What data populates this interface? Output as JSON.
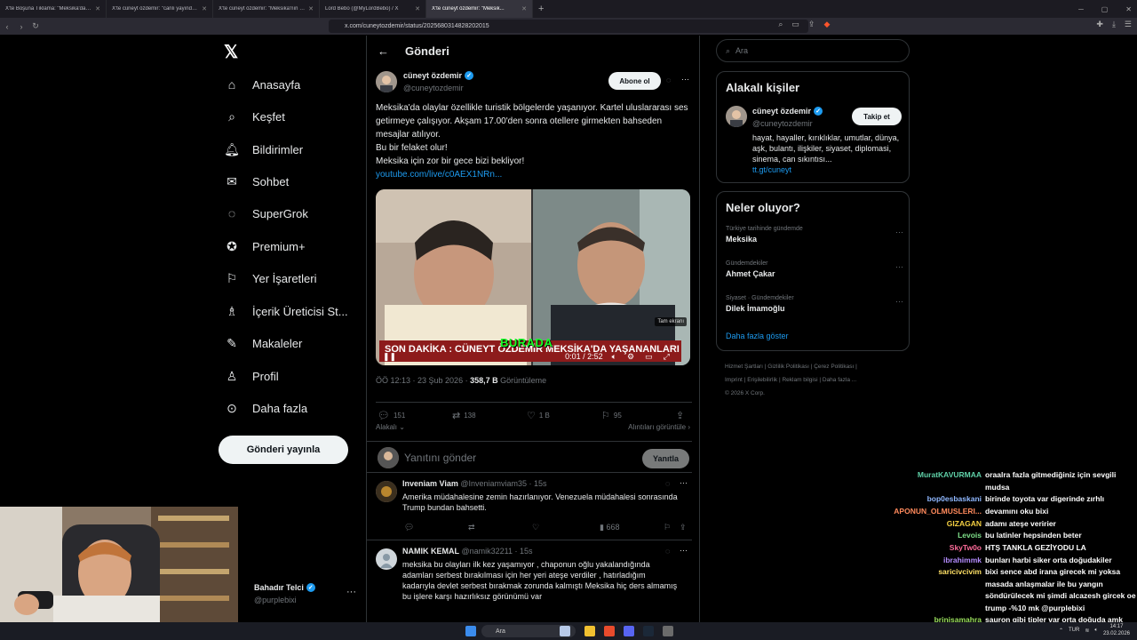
{
  "browser": {
    "tabs": [
      {
        "label": "X'te Boşuna Tıklama: \"Meksika'da ma...",
        "active": false
      },
      {
        "label": "X'te cüneyt özdemir: \"canlı yayındayı...",
        "active": false
      },
      {
        "label": "X'te cüneyt özdemir: \"Meksika'nın sa...",
        "active": false
      },
      {
        "label": "Lord Bebo (@MyLordBebo) / X",
        "active": false
      },
      {
        "label": "X'te cüneyt özdemir: \"Meksik...",
        "active": true
      }
    ],
    "url": "x.com/cuneytozdemir/status/2025680314828202015"
  },
  "nav": {
    "items": [
      {
        "label": "Anasayfa",
        "icon": "home-icon"
      },
      {
        "label": "Keşfet",
        "icon": "search-icon"
      },
      {
        "label": "Bildirimler",
        "icon": "bell-icon"
      },
      {
        "label": "Sohbet",
        "icon": "mail-icon"
      },
      {
        "label": "SuperGrok",
        "icon": "grok-icon"
      },
      {
        "label": "Premium+",
        "icon": "verified-icon"
      },
      {
        "label": "Yer İşaretleri",
        "icon": "bookmark-icon"
      },
      {
        "label": "İçerik Üreticisi St...",
        "icon": "studio-icon"
      },
      {
        "label": "Makaleler",
        "icon": "article-icon"
      },
      {
        "label": "Profil",
        "icon": "person-icon"
      },
      {
        "label": "Daha fazla",
        "icon": "more-circle-icon"
      }
    ],
    "post_button": "Gönderi yayınla",
    "profile": {
      "name": "Bahadır Telci",
      "handle": "@purplebixi"
    }
  },
  "main": {
    "header": "Gönderi",
    "tweet": {
      "author": "cüneyt özdemir",
      "handle": "@cuneytozdemir",
      "subscribe": "Abone ol",
      "lines": [
        "Meksika'da olaylar özellikle turistik bölgelerde yaşanıyor. Kartel uluslararası ses getirmeye çalışıyor. Akşam 17.00'den sonra otellere girmekten bahseden mesajlar atılıyor.",
        "Bu bir felaket olur!",
        "Meksika için zor bir gece bizi bekliyor!"
      ],
      "link": "youtube.com/live/c0AEX1NRn...",
      "video": {
        "fullscreen": "Tam ekranı",
        "overlay": "BURADA",
        "ticker": "SON DAKİKA : CÜNEYT ÖZDEMİR MEKSİKA'DA YAŞANANLARI",
        "time": "0:01 / 2:52"
      },
      "timestamp": "ÖÖ 12:13 · 23 Şub 2026 · ",
      "views": "358,7 B",
      "views_label": " Görüntüleme",
      "stats": {
        "replies": "151",
        "retweets": "138",
        "likes": "1 B",
        "bookmarks": "95"
      },
      "sort": "Alakalı",
      "quotes": "Alıntıları görüntüle"
    },
    "reply_box": {
      "placeholder": "Yanıtını gönder",
      "button": "Yanıtla"
    },
    "replies": [
      {
        "name": "Inveniam Viam",
        "meta": " @Inveniamviam35 · 15s",
        "text": "Amerika müdahalesine zemin hazırlanıyor. Venezuela müdahalesi sonrasında Trump bundan bahsetti.",
        "views": "668"
      },
      {
        "name": "NAMIK KEMAL",
        "meta": " @namik32211 · 15s",
        "text": "meksika bu olayları ilk kez yaşamıyor , chaponun oğlu yakalandığında adamları serbest bırakılması için her yeri ateşe verdiler , hatırladığım kadarıyla devlet serbest bırakmak zorunda kalmıştı Meksika hiç ders almamış bu işlere karşı hazırlıksız görünümü var"
      }
    ]
  },
  "right": {
    "search_placeholder": "Ara",
    "related": {
      "title": "Alakalı kişiler",
      "name": "cüneyt özdemir",
      "handle": "@cuneytozdemir",
      "follow": "Takip et",
      "bio": "hayat, hayaller, kırıklıklar, umutlar, dünya, aşk, bulantı, ilişkiler, siyaset, diplomasi, sinema, can sıkıntısı...",
      "link": "tt.gt/cuneyt"
    },
    "trends": {
      "title": "Neler oluyor?",
      "items": [
        {
          "context": "Türkiye tarihinde gündemde",
          "topic": "Meksika"
        },
        {
          "context": "Gündemdekiler",
          "topic": "Ahmet Çakar"
        },
        {
          "context": "Siyaset · Gündemdekiler",
          "topic": "Dilek İmamoğlu"
        }
      ],
      "show_more": "Daha fazla göster"
    },
    "footer": {
      "links": [
        "Hizmet Şartları",
        "Gizlilik Politikası",
        "Çerez Politikası",
        "Imprint",
        "Erişilebilirlik",
        "Reklam bilgisi",
        "Daha fazla ..."
      ],
      "copyright": "© 2026 X Corp."
    }
  },
  "chat": [
    {
      "user": "MuratKAVURMAA",
      "color": "#5fd1a8",
      "msg": "oraalra fazla gitmediğiniz için sevgili mudsa"
    },
    {
      "user": "bop0esbaskani",
      "color": "#8fb8ff",
      "msg": "birinde toyota var digerinde zırhlı"
    },
    {
      "user": "APONUN_OLMUSLERI...",
      "color": "#ff8a5c",
      "msg": "devamını oku bixi"
    },
    {
      "user": "GIZAGAN",
      "color": "#f5d042",
      "msg": "adamı ateşe veririer"
    },
    {
      "user": "Levois",
      "color": "#7fe08a",
      "msg": "bu latinler hepsinden beter"
    },
    {
      "user": "SkyTw0o",
      "color": "#ff6b9a",
      "msg": "HTŞ TANKLA GEZİYODU LA"
    },
    {
      "user": "ibrahimmk",
      "color": "#b48cff",
      "msg": "bunları harbi siker orta doğudakiler"
    },
    {
      "user": "saricivcivim",
      "color": "#ffe066",
      "msg": "bixi sence abd irana girecek mi yoksa masada anlaşmalar ile bu yangın söndürülecek mi şimdi alcazesh gircek oe trump -%10 mk @purplebixi"
    },
    {
      "user": "brinisamahra",
      "color": "#9be15d",
      "msg": "sauron gibi tipler var orta doğuda amk"
    }
  ],
  "taskbar": {
    "search": "Ara",
    "lang": "TUR",
    "time": "14:17",
    "date": "23.02.2026"
  },
  "colors": {
    "accent": "#1d9bf0",
    "background": "#000000",
    "border": "#2f3336",
    "muted": "#71767b"
  }
}
